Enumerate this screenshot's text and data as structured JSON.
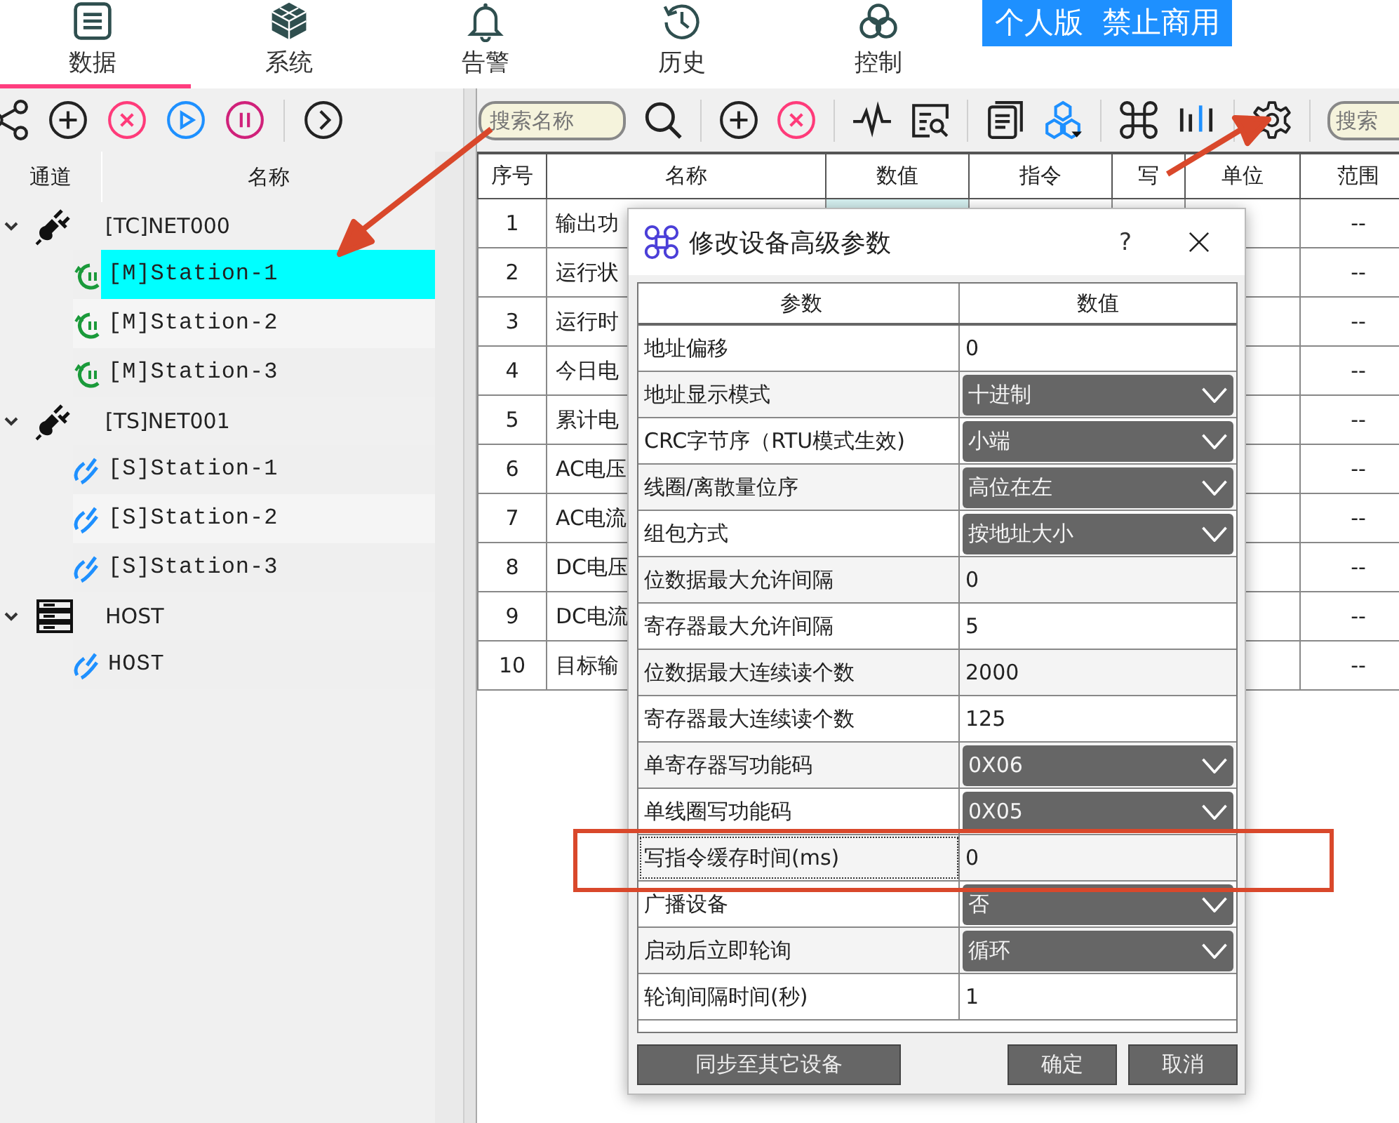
{
  "nav_tabs": [
    {
      "label": "数据",
      "selected": true
    },
    {
      "label": "系统",
      "selected": false
    },
    {
      "label": "告警",
      "selected": false
    },
    {
      "label": "历史",
      "selected": false
    },
    {
      "label": "控制",
      "selected": false
    }
  ],
  "edition_badge": "个人版  禁止商用",
  "search": {
    "placeholder": "搜索名称"
  },
  "search_2": {
    "placeholder": "搜索"
  },
  "tree": {
    "columns": [
      "通道",
      "名称"
    ],
    "groups": [
      {
        "label": "[TC]NET000",
        "kind": "network",
        "expanded": true,
        "children": [
          {
            "label": "[M]Station-1",
            "kind": "master",
            "selected": true
          },
          {
            "label": "[M]Station-2",
            "kind": "master",
            "selected": false
          },
          {
            "label": "[M]Station-3",
            "kind": "master",
            "selected": false
          }
        ]
      },
      {
        "label": "[TS]NET001",
        "kind": "network",
        "expanded": true,
        "children": [
          {
            "label": "[S]Station-1",
            "kind": "slave",
            "selected": false
          },
          {
            "label": "[S]Station-2",
            "kind": "slave",
            "selected": false
          },
          {
            "label": "[S]Station-3",
            "kind": "slave",
            "selected": false
          }
        ]
      },
      {
        "label": "HOST",
        "kind": "host",
        "expanded": true,
        "children": [
          {
            "label": "HOST",
            "kind": "slave",
            "selected": false
          }
        ]
      }
    ]
  },
  "table": {
    "columns": [
      "序号",
      "名称",
      "数值",
      "指令",
      "写",
      "单位",
      "范围"
    ],
    "rows": [
      {
        "index": "1",
        "name": "输出功",
        "range": "--"
      },
      {
        "index": "2",
        "name": "运行状",
        "range": "--"
      },
      {
        "index": "3",
        "name": "运行时",
        "range": "--"
      },
      {
        "index": "4",
        "name": "今日电",
        "range": "--"
      },
      {
        "index": "5",
        "name": "累计电",
        "range": "--"
      },
      {
        "index": "6",
        "name": "AC电压",
        "range": "--"
      },
      {
        "index": "7",
        "name": "AC电流",
        "range": "--"
      },
      {
        "index": "8",
        "name": "DC电压",
        "range": "--"
      },
      {
        "index": "9",
        "name": "DC电流",
        "range": "--"
      },
      {
        "index": "10",
        "name": "目标输",
        "range": "--"
      }
    ]
  },
  "dialog": {
    "title": "修改设备高级参数",
    "help": "?",
    "columns": [
      "参数",
      "数值"
    ],
    "rows": [
      {
        "label": "地址偏移",
        "value": "0",
        "kind": "text",
        "selected": false
      },
      {
        "label": "地址显示模式",
        "value": "十进制",
        "kind": "dropdown",
        "selected": false
      },
      {
        "label": "CRC字节序（RTU模式生效)",
        "value": "小端",
        "kind": "dropdown",
        "selected": false
      },
      {
        "label": "线圈/离散量位序",
        "value": "高位在左",
        "kind": "dropdown",
        "selected": false
      },
      {
        "label": "组包方式",
        "value": "按地址大小",
        "kind": "dropdown",
        "selected": false
      },
      {
        "label": "位数据最大允许间隔",
        "value": "0",
        "kind": "text",
        "selected": false
      },
      {
        "label": "寄存器最大允许间隔",
        "value": "5",
        "kind": "text",
        "selected": false
      },
      {
        "label": "位数据最大连续读个数",
        "value": "2000",
        "kind": "text",
        "selected": false
      },
      {
        "label": "寄存器最大连续读个数",
        "value": "125",
        "kind": "text",
        "selected": false
      },
      {
        "label": "单寄存器写功能码",
        "value": "0X06",
        "kind": "dropdown",
        "selected": false
      },
      {
        "label": "单线圈写功能码",
        "value": "0X05",
        "kind": "dropdown",
        "selected": false
      },
      {
        "label": "写指令缓存时间(ms)",
        "value": "0",
        "kind": "text",
        "selected": true
      },
      {
        "label": "广播设备",
        "value": "否",
        "kind": "dropdown",
        "selected": false
      },
      {
        "label": "启动后立即轮询",
        "value": "循环",
        "kind": "dropdown",
        "selected": false
      },
      {
        "label": "轮询间隔时间(秒)",
        "value": "1",
        "kind": "text",
        "selected": false
      }
    ],
    "buttons": {
      "sync": "同步至其它设备",
      "ok": "确定",
      "cancel": "取消"
    }
  }
}
